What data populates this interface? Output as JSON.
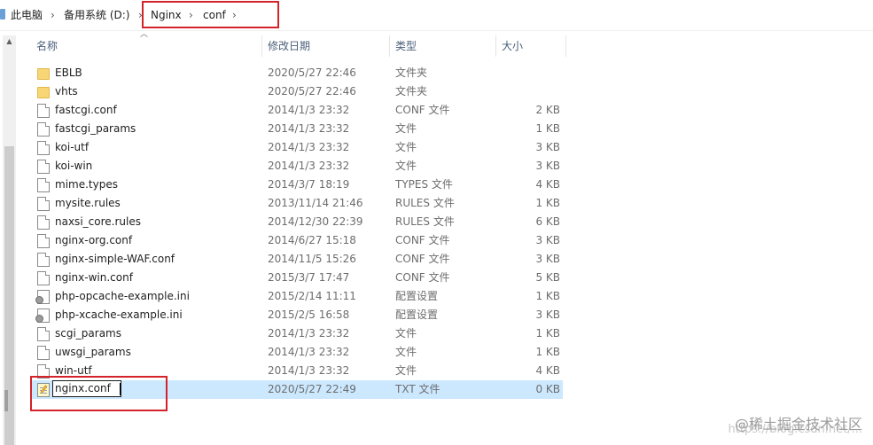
{
  "breadcrumb": {
    "items": [
      "此电脑",
      "备用系统 (D:)",
      "Nginx",
      "conf"
    ],
    "separator": "›"
  },
  "columns": {
    "name": "名称",
    "date": "修改日期",
    "type": "类型",
    "size": "大小"
  },
  "files": [
    {
      "name": "EBLB",
      "date": "2020/5/27 22:46",
      "type": "文件夹",
      "size": "",
      "icon": "folder-icon"
    },
    {
      "name": "vhts",
      "date": "2020/5/27 22:46",
      "type": "文件夹",
      "size": "",
      "icon": "folder-icon"
    },
    {
      "name": "fastcgi.conf",
      "date": "2014/1/3 23:32",
      "type": "CONF 文件",
      "size": "2 KB",
      "icon": "file-icon"
    },
    {
      "name": "fastcgi_params",
      "date": "2014/1/3 23:32",
      "type": "文件",
      "size": "1 KB",
      "icon": "file-icon"
    },
    {
      "name": "koi-utf",
      "date": "2014/1/3 23:32",
      "type": "文件",
      "size": "3 KB",
      "icon": "file-icon"
    },
    {
      "name": "koi-win",
      "date": "2014/1/3 23:32",
      "type": "文件",
      "size": "3 KB",
      "icon": "file-icon"
    },
    {
      "name": "mime.types",
      "date": "2014/3/7 18:19",
      "type": "TYPES 文件",
      "size": "4 KB",
      "icon": "file-icon"
    },
    {
      "name": "mysite.rules",
      "date": "2013/11/14 21:46",
      "type": "RULES 文件",
      "size": "1 KB",
      "icon": "file-icon"
    },
    {
      "name": "naxsi_core.rules",
      "date": "2014/12/30 22:39",
      "type": "RULES 文件",
      "size": "6 KB",
      "icon": "file-icon"
    },
    {
      "name": "nginx-org.conf",
      "date": "2014/6/27 15:18",
      "type": "CONF 文件",
      "size": "3 KB",
      "icon": "file-icon"
    },
    {
      "name": "nginx-simple-WAF.conf",
      "date": "2014/11/5 15:26",
      "type": "CONF 文件",
      "size": "3 KB",
      "icon": "file-icon"
    },
    {
      "name": "nginx-win.conf",
      "date": "2015/3/7 17:47",
      "type": "CONF 文件",
      "size": "5 KB",
      "icon": "file-icon"
    },
    {
      "name": "php-opcache-example.ini",
      "date": "2015/2/14 11:11",
      "type": "配置设置",
      "size": "1 KB",
      "icon": "settings-file-icon"
    },
    {
      "name": "php-xcache-example.ini",
      "date": "2015/2/5 16:58",
      "type": "配置设置",
      "size": "3 KB",
      "icon": "settings-file-icon"
    },
    {
      "name": "scgi_params",
      "date": "2014/1/3 23:32",
      "type": "文件",
      "size": "1 KB",
      "icon": "file-icon"
    },
    {
      "name": "uwsgi_params",
      "date": "2014/1/3 23:32",
      "type": "文件",
      "size": "1 KB",
      "icon": "file-icon"
    },
    {
      "name": "win-utf",
      "date": "2014/1/3 23:32",
      "type": "文件",
      "size": "4 KB",
      "icon": "file-icon"
    }
  ],
  "new_file": {
    "name": "nginx.conf",
    "date": "2020/5/27 22:49",
    "type": "TXT 文件",
    "size": "0 KB",
    "icon": "text-file-icon"
  },
  "watermark": {
    "text": "@稀土掘金技术社区",
    "url": "https://blog.csdn.net/..."
  },
  "colors": {
    "highlight_red": "#d4232a",
    "selection_blue": "#cce8ff"
  }
}
